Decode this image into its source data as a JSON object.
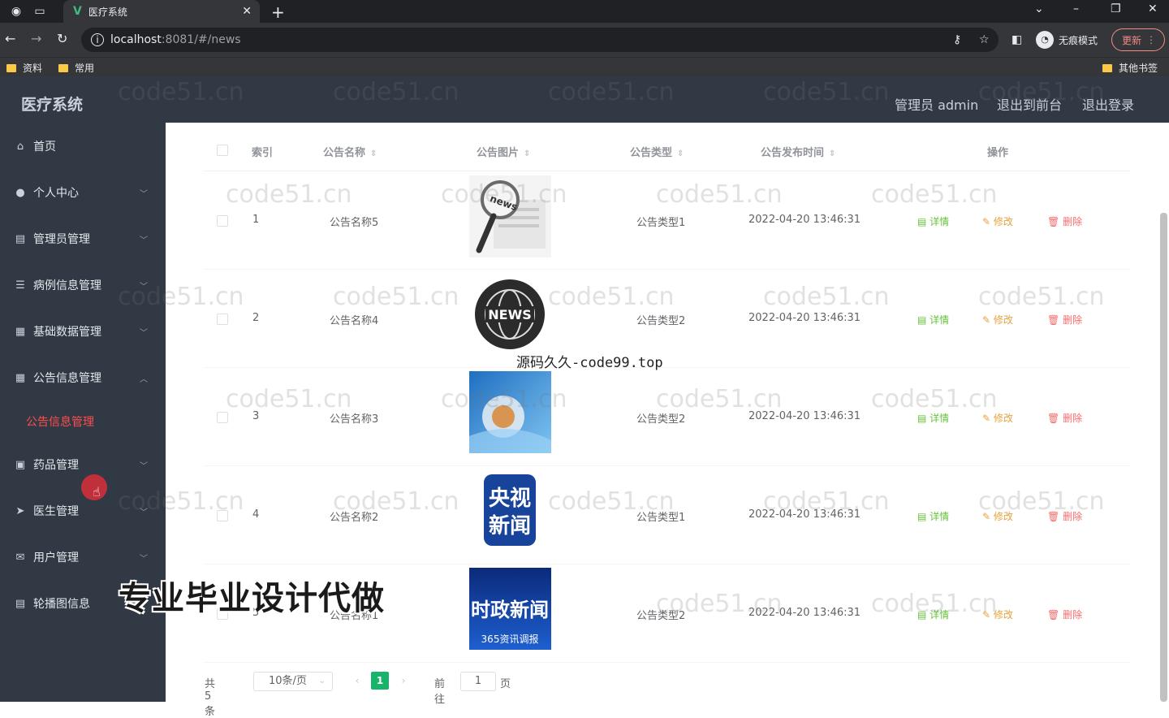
{
  "browser": {
    "tab_title": "医疗系统",
    "url_host": "localhost",
    "url_rest": ":8081/#/news",
    "incognito_label": "无痕模式",
    "update_label": "更新",
    "bookmarks": [
      "资料",
      "常用"
    ],
    "other_bookmarks": "其他书签"
  },
  "header": {
    "title": "医疗系统",
    "user": "管理员 admin",
    "to_front": "退出到前台",
    "logout": "退出登录"
  },
  "sidebar": {
    "items": [
      {
        "label": "首页",
        "icon": "home-icon"
      },
      {
        "label": "个人中心",
        "icon": "user-icon"
      },
      {
        "label": "管理员管理",
        "icon": "document-icon"
      },
      {
        "label": "病例信息管理",
        "icon": "list-icon"
      },
      {
        "label": "基础数据管理",
        "icon": "grid-icon"
      },
      {
        "label": "公告信息管理",
        "icon": "grid-icon"
      },
      {
        "label": "药品管理",
        "icon": "image-icon"
      },
      {
        "label": "医生管理",
        "icon": "send-icon"
      },
      {
        "label": "用户管理",
        "icon": "mail-icon"
      },
      {
        "label": "轮播图信息",
        "icon": "document-icon"
      }
    ],
    "active_submenu": "公告信息管理"
  },
  "table": {
    "headers": {
      "index": "索引",
      "name": "公告名称",
      "image": "公告图片",
      "type": "公告类型",
      "time": "公告发布时间",
      "actions": "操作"
    },
    "rows": [
      {
        "index": "1",
        "name": "公告名称5",
        "type": "公告类型1",
        "time": "2022-04-20 13:46:31"
      },
      {
        "index": "2",
        "name": "公告名称4",
        "type": "公告类型2",
        "time": "2022-04-20 13:46:31"
      },
      {
        "index": "3",
        "name": "公告名称3",
        "type": "公告类型2",
        "time": "2022-04-20 13:46:31"
      },
      {
        "index": "4",
        "name": "公告名称2",
        "type": "公告类型1",
        "time": "2022-04-20 13:46:31"
      },
      {
        "index": "5",
        "name": "公告名称1",
        "type": "公告类型2",
        "time": "2022-04-20 13:46:31"
      }
    ],
    "actions": {
      "detail": "详情",
      "edit": "修改",
      "delete": "删除"
    }
  },
  "images": {
    "news_badge": "NEWS",
    "news_magnifier": "news",
    "cctv_line1": "央视",
    "cctv_line2": "新闻",
    "politics_title": "时政新闻",
    "politics_sub": "365资讯调报"
  },
  "pagination": {
    "total": "共 5 条",
    "page_size": "10条/页",
    "current": "1",
    "goto": "前往",
    "goto_value": "1",
    "unit": "页"
  },
  "overlays": {
    "watermark": "code51.cn",
    "source_text": "源码久久-code99.top",
    "promo": "专业毕业设计代做"
  }
}
